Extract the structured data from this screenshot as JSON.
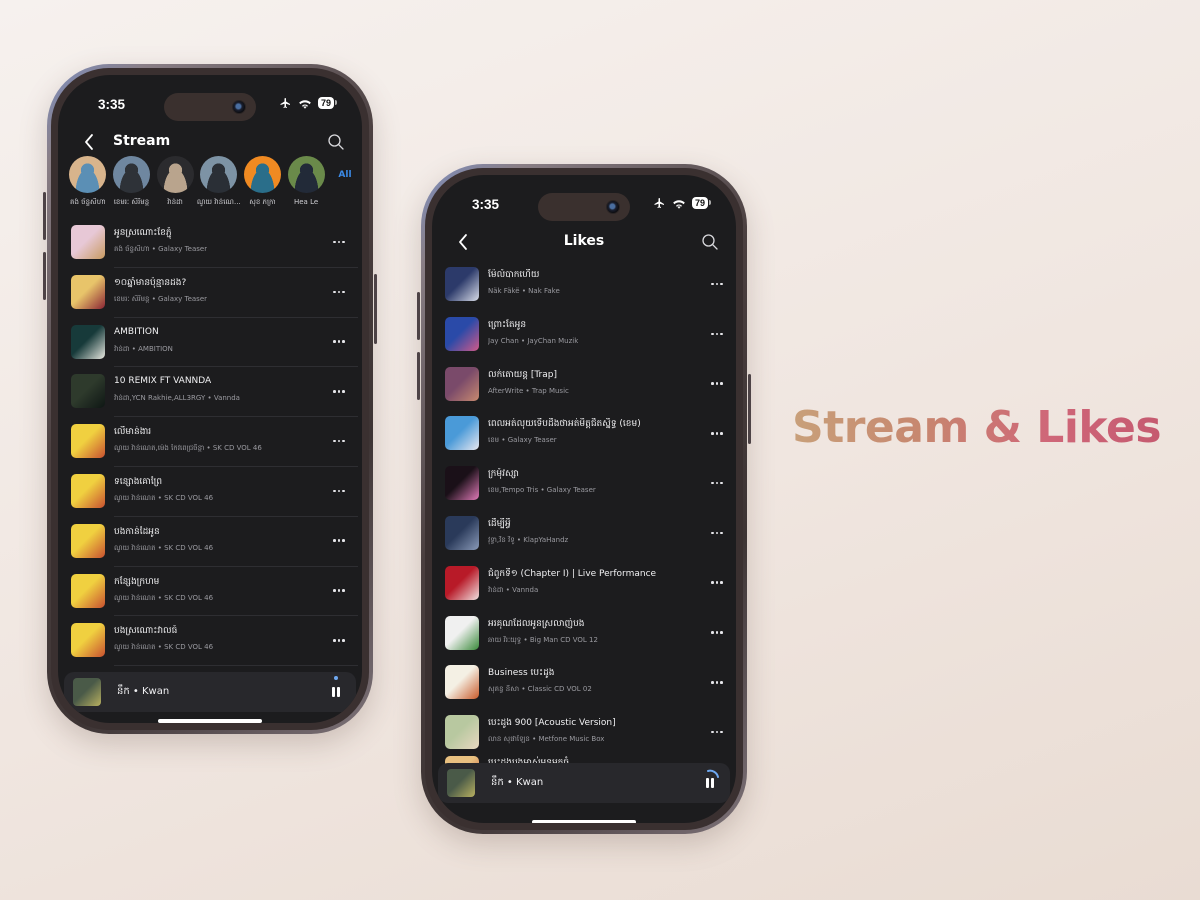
{
  "headline": "Stream & Likes",
  "colors": {
    "accent": "#3b8be8",
    "screen_bg": "#1c1c1e",
    "mini_player_bg": "#28282c",
    "headline_gradient": [
      "#c8a07a",
      "#c7876f",
      "#cf6678",
      "#c55a70"
    ]
  },
  "stream": {
    "status": {
      "time": "3:35",
      "battery": "79"
    },
    "title": "Stream",
    "artists": [
      {
        "name": "គង់ ច័ន្ទសីហា",
        "colors": [
          "#d8b48c",
          "#5b8fb5"
        ]
      },
      {
        "name": "ខេមរៈ សិរីមន្ត",
        "colors": [
          "#6f87a0",
          "#2e3238"
        ]
      },
      {
        "name": "វ៉ាន់ដា",
        "colors": [
          "#2b2b2e",
          "#b9a48d"
        ]
      },
      {
        "name": "ណូយ វ៉ាន់ណេ...",
        "colors": [
          "#7d93a5",
          "#2a2f36"
        ]
      },
      {
        "name": "សុខ ភក្រា",
        "colors": [
          "#f08a22",
          "#2a6e8a"
        ]
      },
      {
        "name": "Hea Le",
        "colors": [
          "#6a8a4a",
          "#222a38"
        ]
      }
    ],
    "all_label": "All",
    "songs": [
      {
        "title": "អូនស្រណោះខែភ្ជុំ",
        "subtitle": "គង់ ច័ន្ទសីហា • Galaxy Teaser",
        "art": [
          "#e7c8d6",
          "#c89a60"
        ]
      },
      {
        "title": "១០ឆ្នាំមានប៉ុន្មានដង?",
        "subtitle": "ខេមរៈ សិរីមន្ត • Galaxy Teaser",
        "art": [
          "#e8c46a",
          "#8a2434"
        ]
      },
      {
        "title": "AMBITION",
        "subtitle": "វ៉ាន់ដា • AMBITION",
        "art": [
          "#173a3a",
          "#e8e8e0"
        ]
      },
      {
        "title": "10 REMIX FT VANNDA",
        "subtitle": "វ៉ាន់ដា,YCN Rakhie,ALL3RGY • Vannda",
        "art": [
          "#2e3a2c",
          "#0e1614"
        ]
      },
      {
        "title": "លើមាន់ងារ",
        "subtitle": "ណូយ វ៉ាន់ណេត,ម៉េង កែវពេជ្រចិន្តា • SK CD VOL 46",
        "art": [
          "#f0d040",
          "#c85030"
        ]
      },
      {
        "title": "ទន្សោងគោព្រៃ",
        "subtitle": "ណូយ វ៉ាន់ណេត • SK CD VOL 46",
        "art": [
          "#f0d040",
          "#c85030"
        ]
      },
      {
        "title": "បងកាន់ដៃអូន",
        "subtitle": "ណូយ វ៉ាន់ណេត • SK CD VOL 46",
        "art": [
          "#f0d040",
          "#c85030"
        ]
      },
      {
        "title": "កន្សែងក្រហម",
        "subtitle": "ណូយ វ៉ាន់ណេត • SK CD VOL 46",
        "art": [
          "#f0d040",
          "#c85030"
        ]
      },
      {
        "title": "បងស្រណោះវាលធំ",
        "subtitle": "ណូយ វ៉ាន់ណេត • SK CD VOL 46",
        "art": [
          "#f0d040",
          "#c85030"
        ]
      }
    ],
    "now_playing": {
      "label": "នឹក • Kwan",
      "art": [
        "#4a5a48",
        "#b8b060"
      ]
    }
  },
  "likes": {
    "status": {
      "time": "3:35",
      "battery": "79"
    },
    "title": "Likes",
    "songs": [
      {
        "title": "ម៉ែលំបាកហើយ",
        "subtitle": "Näk Fäkë • Nak Fake",
        "art": [
          "#2c3a6a",
          "#d8dce8"
        ]
      },
      {
        "title": "ព្រោះតែអូន",
        "subtitle": "Jay Chan • JayChan Muzik",
        "art": [
          "#2a4aa8",
          "#d05a8a"
        ]
      },
      {
        "title": "លក់តោយន្ត [Trap]",
        "subtitle": "AfterWrite • Trap Music",
        "art": [
          "#7a4a6a",
          "#c88a70"
        ]
      },
      {
        "title": "ពេលអត់លុយទើបដឹងថាអត់មិត្តជិតស្និទ្ធ (ខេម)",
        "subtitle": "ខេម • Galaxy Teaser",
        "art": [
          "#4a9ad8",
          "#e8e8f0"
        ]
      },
      {
        "title": "ក្រមុំវស្សា",
        "subtitle": "ខេម,Tempo Tris • Galaxy Teaser",
        "art": [
          "#1a1018",
          "#e07ab8"
        ]
      },
      {
        "title": "ដើម្បីអ្វី",
        "subtitle": "វុទ្ធា,វិន វិទូ • KlapYaHandz",
        "art": [
          "#2a3a5a",
          "#8a9ab8"
        ]
      },
      {
        "title": "ជំពូកទី១ (Chapter I) | Live Performance",
        "subtitle": "វ៉ាន់ដា • Vannda",
        "art": [
          "#b81a28",
          "#f0e0e0"
        ]
      },
      {
        "title": "អរគុណដែលអូនស្រលាញ់បង",
        "subtitle": "ឆាយ វីរៈយុទ្ធ • Big Man CD VOL 12",
        "art": [
          "#f0f0f0",
          "#3a8a3a"
        ]
      },
      {
        "title": "Business បេះដូង",
        "subtitle": "សុគន្ធ នីសា • Classic CD VOL 02",
        "art": [
          "#f4f0e4",
          "#c85a2a"
        ]
      },
      {
        "title": "បេះដូង 900 [Acoustic Version]",
        "subtitle": "លាន សុផាឡែន • Metfone Music Box",
        "art": [
          "#b8c8a0",
          "#e8d8c0"
        ]
      }
    ],
    "partial_song": {
      "title": "បេះដូងបងម្ចាស់អូនអ្នកធំ",
      "art": [
        "#e8c080",
        "#c04a30"
      ]
    },
    "now_playing": {
      "label": "នឹក • Kwan",
      "art": [
        "#4a5a48",
        "#b8b060"
      ]
    }
  }
}
